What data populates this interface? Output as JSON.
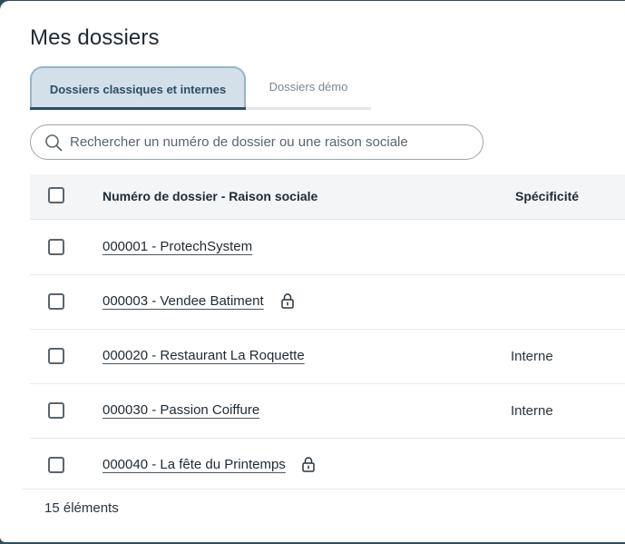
{
  "page": {
    "title": "Mes dossiers"
  },
  "tabs": [
    {
      "label": "Dossiers classiques et internes",
      "active": true
    },
    {
      "label": "Dossiers démo",
      "active": false
    }
  ],
  "search": {
    "placeholder": "Rechercher un numéro de dossier ou une raison sociale",
    "value": ""
  },
  "table": {
    "columns": [
      "Numéro de dossier - Raison sociale",
      "Spécificité"
    ],
    "rows": [
      {
        "label": "000001 - ProtechSystem",
        "specificite": "",
        "locked": false
      },
      {
        "label": "000003 - Vendee Batiment",
        "specificite": "",
        "locked": true
      },
      {
        "label": "000020 - Restaurant La Roquette",
        "specificite": "Interne",
        "locked": false
      },
      {
        "label": "000030 - Passion Coiffure",
        "specificite": "Interne",
        "locked": false
      },
      {
        "label": "000040 - La fête du Printemps",
        "specificite": "",
        "locked": true
      }
    ]
  },
  "footer": {
    "count": "15 éléments"
  },
  "colors": {
    "accent": "#2b4d63",
    "tab_active_bg": "#d3e0e9",
    "frame": "#2f4d5a"
  },
  "icons": {
    "search": "search-icon",
    "lock": "lock-icon"
  }
}
